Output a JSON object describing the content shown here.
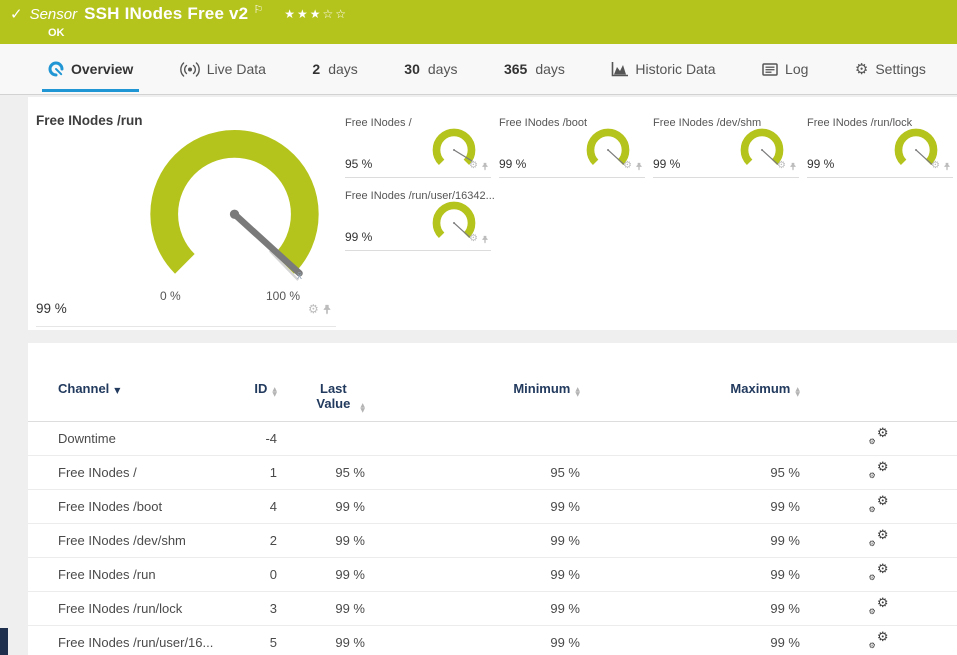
{
  "header": {
    "kind_label": "Sensor",
    "title": "SSH INodes Free v2",
    "status": "OK",
    "stars_filled": "★★★",
    "stars_empty": "☆☆",
    "check": "✓",
    "flag": "⚐"
  },
  "tabs": [
    {
      "label": "Overview",
      "icon": "gauge-icon",
      "active": true
    },
    {
      "label": "Live Data",
      "icon": "live-icon"
    },
    {
      "prefix": "2",
      "label": "days"
    },
    {
      "prefix": "30",
      "label": "days"
    },
    {
      "prefix": "365",
      "label": "days"
    },
    {
      "label": "Historic Data",
      "icon": "historic-icon"
    },
    {
      "label": "Log",
      "icon": "log-icon"
    },
    {
      "label": "Settings",
      "icon": "settings-icon"
    }
  ],
  "overview": {
    "main_gauge": {
      "title": "Free INodes /run",
      "value_label": "99 %",
      "value_pct": 99,
      "scale_min": "0 %",
      "scale_max": "100 %",
      "mean_marker": "x̄"
    },
    "small_gauges": [
      {
        "title": "Free INodes /",
        "value_label": "95 %",
        "value_pct": 95
      },
      {
        "title": "Free INodes /boot",
        "value_label": "99 %",
        "value_pct": 99
      },
      {
        "title": "Free INodes /dev/shm",
        "value_label": "99 %",
        "value_pct": 99
      },
      {
        "title": "Free INodes /run/lock",
        "value_label": "99 %",
        "value_pct": 99
      },
      {
        "title": "Free INodes /run/user/16342...",
        "value_label": "99 %",
        "value_pct": 99
      }
    ]
  },
  "table": {
    "columns": [
      "Channel",
      "ID",
      "Last Value",
      "Minimum",
      "Maximum"
    ],
    "rows": [
      {
        "channel": "Downtime",
        "id": "-4",
        "last": "",
        "min": "",
        "max": ""
      },
      {
        "channel": "Free INodes /",
        "id": "1",
        "last": "95 %",
        "min": "95 %",
        "max": "95 %"
      },
      {
        "channel": "Free INodes /boot",
        "id": "4",
        "last": "99 %",
        "min": "99 %",
        "max": "99 %"
      },
      {
        "channel": "Free INodes /dev/shm",
        "id": "2",
        "last": "99 %",
        "min": "99 %",
        "max": "99 %"
      },
      {
        "channel": "Free INodes /run",
        "id": "0",
        "last": "99 %",
        "min": "99 %",
        "max": "99 %"
      },
      {
        "channel": "Free INodes /run/lock",
        "id": "3",
        "last": "99 %",
        "min": "99 %",
        "max": "99 %"
      },
      {
        "channel": "Free INodes /run/user/16...",
        "id": "5",
        "last": "99 %",
        "min": "99 %",
        "max": "99 %"
      }
    ]
  },
  "colors": {
    "status_ok": "#b5c31d",
    "accent_blue": "#2196d4",
    "needle_gray": "#7a7a7a"
  }
}
